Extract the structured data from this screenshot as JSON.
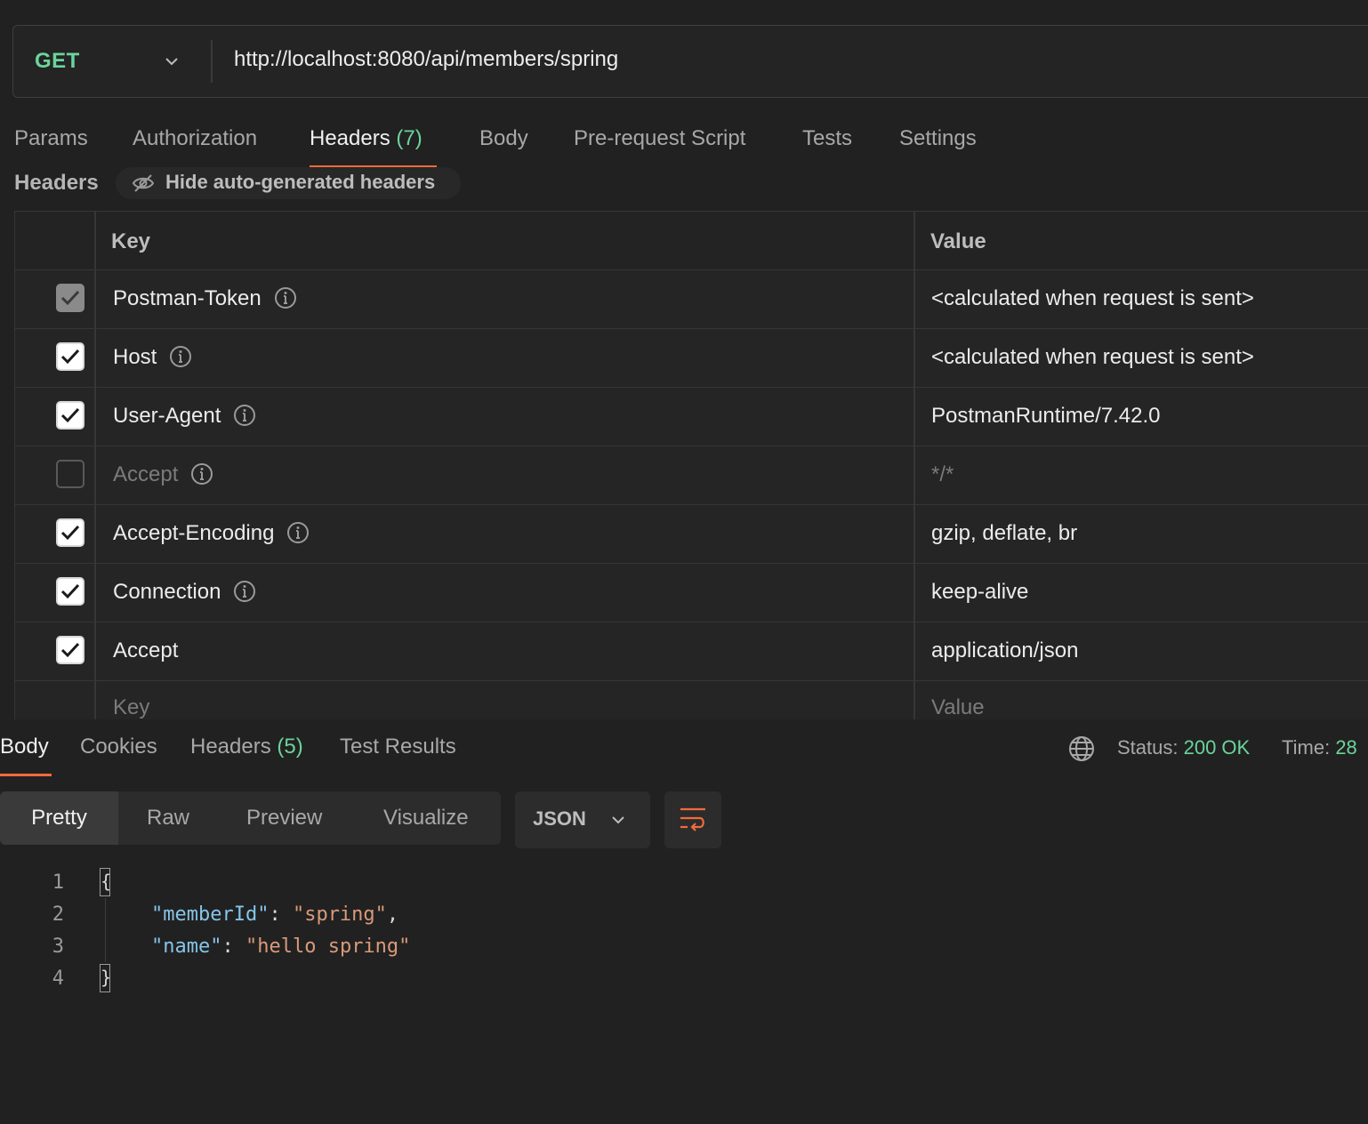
{
  "request": {
    "method": "GET",
    "url": "http://localhost:8080/api/members/spring"
  },
  "request_tabs": {
    "params": "Params",
    "authorization": "Authorization",
    "headers": "Headers",
    "headers_count": "(7)",
    "body": "Body",
    "prerequest": "Pre-request Script",
    "tests": "Tests",
    "settings": "Settings"
  },
  "headers_section": {
    "title": "Headers",
    "hide_button": "Hide auto-generated headers",
    "col_key": "Key",
    "col_value": "Value",
    "rows": [
      {
        "key": "Postman-Token",
        "value": "<calculated when request is sent>"
      },
      {
        "key": "Host",
        "value": "<calculated when request is sent>"
      },
      {
        "key": "User-Agent",
        "value": "PostmanRuntime/7.42.0"
      },
      {
        "key": "Accept",
        "value": "*/*"
      },
      {
        "key": "Accept-Encoding",
        "value": "gzip, deflate, br"
      },
      {
        "key": "Connection",
        "value": "keep-alive"
      },
      {
        "key": "Accept",
        "value": "application/json"
      }
    ],
    "new_key_placeholder": "Key",
    "new_value_placeholder": "Value"
  },
  "response_tabs": {
    "body": "Body",
    "cookies": "Cookies",
    "headers": "Headers",
    "headers_count": "(5)",
    "test_results": "Test Results"
  },
  "response_status": {
    "status_label": "Status:",
    "status_value": "200 OK",
    "time_label": "Time:",
    "time_value": "28"
  },
  "view_modes": {
    "pretty": "Pretty",
    "raw": "Raw",
    "preview": "Preview",
    "visualize": "Visualize"
  },
  "format": "JSON",
  "code": {
    "line_numbers": [
      "1",
      "2",
      "3",
      "4"
    ],
    "open_brace": "{",
    "close_brace": "}",
    "key1": "\"memberId\"",
    "val1": "\"spring\"",
    "key2": "\"name\"",
    "val2": "\"hello spring\"",
    "colon": ": ",
    "comma": ","
  },
  "colors": {
    "accent": "#f26b3a",
    "success": "#6bd49b",
    "background": "#212121"
  }
}
